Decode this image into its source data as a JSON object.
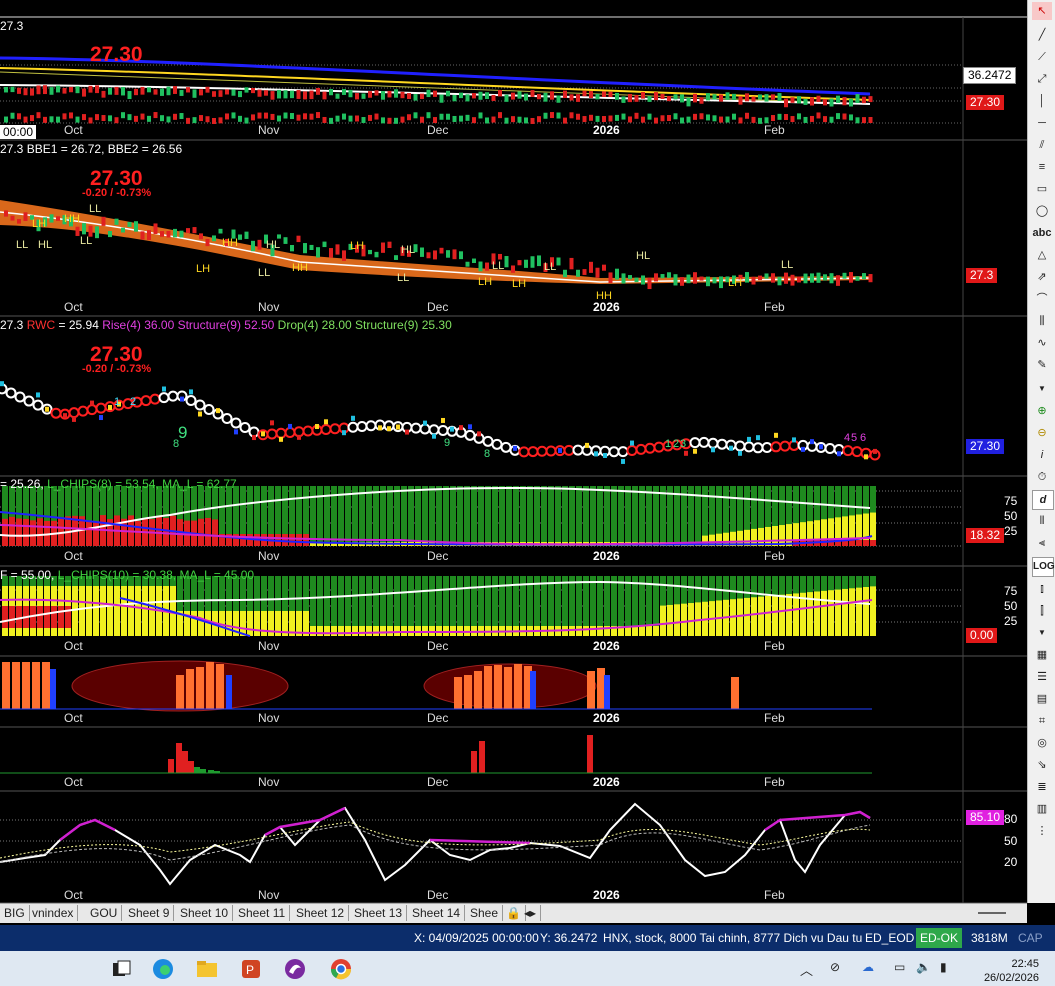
{
  "pane1": {
    "header": "27.3",
    "big_price": "27.30",
    "tag_top": "36.2472",
    "tag_price": "27.30",
    "cursor_time": "00:00",
    "months": [
      "Oct",
      "Nov",
      "Dec",
      "2026",
      "Feb"
    ]
  },
  "pane2": {
    "header": "27.3 BBE1 = 26.72, BBE2 = 26.56",
    "big_price": "27.30",
    "change": "-0.20 / -0.73%",
    "tag_price": "27.3",
    "markers": [
      "LH",
      "HH",
      "LL",
      "LL",
      "HL",
      "LL",
      "LH",
      "HH",
      "LL",
      "HL",
      "HH",
      "LH",
      "LL",
      "HL",
      "LH",
      "LL",
      "LH",
      "LL",
      "HH",
      "HL",
      "LH",
      "LL"
    ],
    "months": [
      "Oct",
      "Nov",
      "Dec",
      "2026",
      "Feb"
    ]
  },
  "pane3": {
    "header_prefix": "27.3",
    "header_rwc_label": "RWC",
    "header_rwc_value": "= 25.94",
    "header_rise": "Rise(4) 36.00 Structure(9) 52.50",
    "header_drop": "Drop(4) 28.00 Structure(9) 25.30",
    "big_price": "27.30",
    "change": "-0.20 / -0.73%",
    "tag_price": "27.30",
    "count_labels": [
      "1",
      "2",
      "9",
      "8",
      "9",
      "8",
      "1",
      "2",
      "3",
      "4",
      "5",
      "6"
    ]
  },
  "pane4": {
    "header_a": "= 25.26,",
    "header_b": "L_CHIPS(8) = 53.54, MA_L = 62.77",
    "tag": "18.32",
    "yticks": [
      "75",
      "50",
      "25"
    ],
    "months": [
      "Oct",
      "Nov",
      "Dec",
      "2026",
      "Feb"
    ]
  },
  "pane5": {
    "header_a": "F = 55.00,",
    "header_b": "L_CHIPS(10) = 30.38, MA_L = 45.00",
    "tag": "0.00",
    "yticks": [
      "75",
      "50",
      "25"
    ],
    "months": [
      "Oct",
      "Nov",
      "Dec",
      "2026",
      "Feb"
    ]
  },
  "pane6": {
    "months": [
      "Oct",
      "Nov",
      "Dec",
      "2026",
      "Feb"
    ]
  },
  "pane7": {
    "months": [
      "Oct",
      "Nov",
      "Dec",
      "2026",
      "Feb"
    ]
  },
  "pane8": {
    "tag": "85.10",
    "yticks": [
      "80",
      "50",
      "20"
    ],
    "months": [
      "Oct",
      "Nov",
      "Dec",
      "2026",
      "Feb"
    ]
  },
  "tabs": [
    "BIG",
    "vnindex",
    "GOU",
    "Sheet 9",
    "Sheet 10",
    "Sheet 11",
    "Sheet 12",
    "Sheet 13",
    "Sheet 14",
    "Shee"
  ],
  "status": {
    "x": "X: 04/09/2025 00:00:00",
    "y": "Y: 36.2472",
    "info": "HNX, stock, 8000 Tai chinh, 8777 Dich vu Dau tu",
    "db": "ED_EOD",
    "state": "ED-OK",
    "mem": "3818M",
    "cap": "CAP"
  },
  "toolbar": {
    "abc": "abc",
    "log": "LOG",
    "d": "d",
    "i": "i"
  },
  "clock": {
    "time": "22:45",
    "date": "26/02/2026"
  },
  "colors": {
    "up": "#20c060",
    "down": "#e02020",
    "cloud": "#ff7a20",
    "green_area": "#1f8a1f",
    "yellow": "#f0f020",
    "magenta": "#d020d0",
    "status_bg": "#0c2d6b"
  }
}
